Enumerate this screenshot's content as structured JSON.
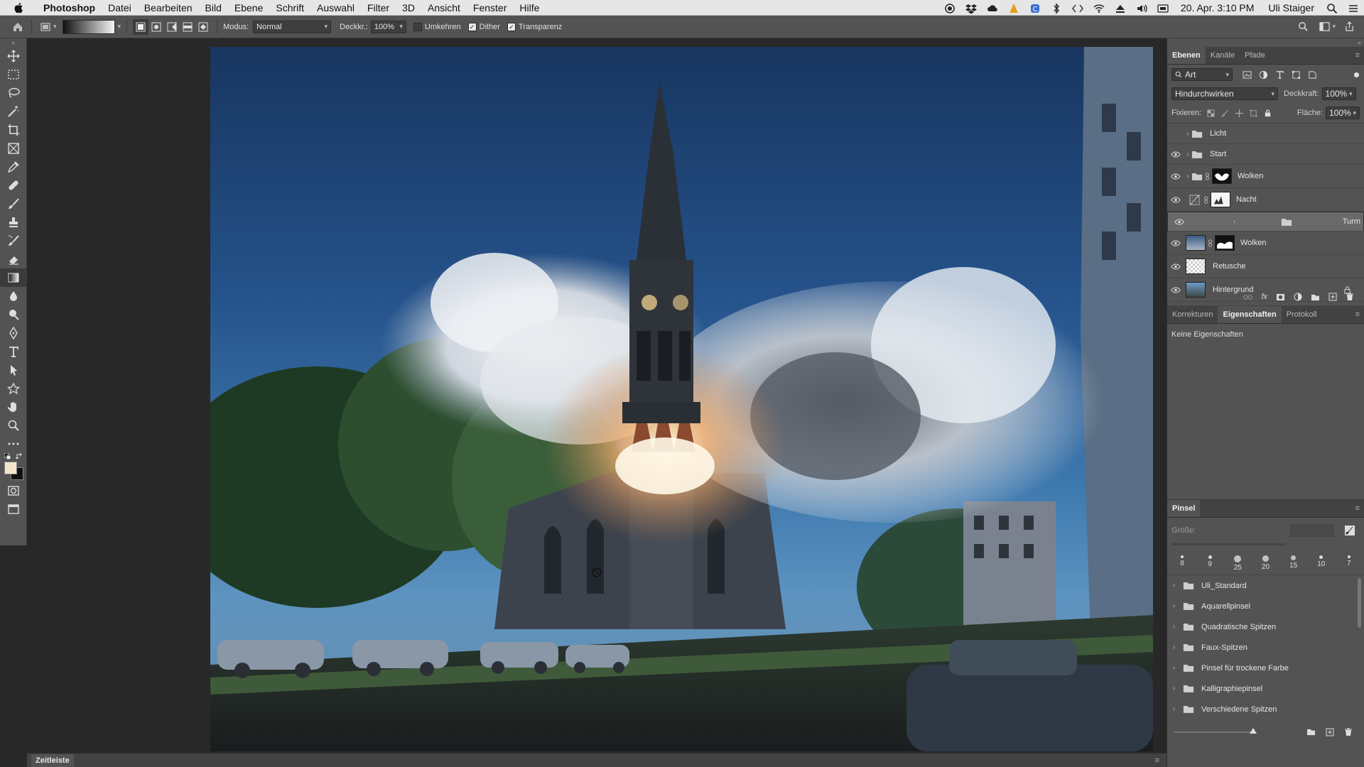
{
  "menubar": {
    "items": [
      "Photoshop",
      "Datei",
      "Bearbeiten",
      "Bild",
      "Ebene",
      "Schrift",
      "Auswahl",
      "Filter",
      "3D",
      "Ansicht",
      "Fenster",
      "Hilfe"
    ],
    "clock": "20. Apr. 3:10 PM",
    "user": "Uli Staiger"
  },
  "options": {
    "mode_label": "Modus:",
    "mode_value": "Normal",
    "opacity_label": "Deckkr.:",
    "opacity_value": "100%",
    "reverse_label": "Umkehren",
    "dither_label": "Dither",
    "transparency_label": "Transparenz",
    "reverse_checked": false,
    "dither_checked": true,
    "transparency_checked": true
  },
  "layers_panel": {
    "tabs": [
      "Ebenen",
      "Kanäle",
      "Pfade"
    ],
    "filter_value": "Art",
    "blend_value": "Hindurchwirken",
    "opacity_label": "Deckkraft:",
    "opacity_value": "100%",
    "lock_label": "Fixieren:",
    "fill_label": "Fläche:",
    "fill_value": "100%",
    "layers": [
      {
        "name": "Licht",
        "type": "group",
        "visible": false
      },
      {
        "name": "Start",
        "type": "group",
        "visible": true
      },
      {
        "name": "Wolken",
        "type": "group-mask",
        "visible": true
      },
      {
        "name": "Nacht",
        "type": "adjustment",
        "visible": true
      },
      {
        "name": "Turm",
        "type": "group",
        "visible": true,
        "selected": true
      },
      {
        "name": "Wolken",
        "type": "image-mask",
        "visible": true
      },
      {
        "name": "Retusche",
        "type": "transparent",
        "visible": true
      },
      {
        "name": "Hintergrund",
        "type": "image",
        "visible": true,
        "locked": true
      }
    ]
  },
  "properties_panel": {
    "tabs": [
      "Korrekturen",
      "Eigenschaften",
      "Protokoll"
    ],
    "empty_text": "Keine Eigenschaften"
  },
  "brush_panel": {
    "title": "Pinsel",
    "size_label": "Größe:",
    "tips": [
      "8",
      "9",
      "25",
      "20",
      "15",
      "10",
      "7"
    ],
    "folders": [
      "Uli_Standard",
      "Aquarellpinsel",
      "Quadratische Spitzen",
      "Faux-Spitzen",
      "Pinsel für trockene Farbe",
      "Kalligraphiepinsel",
      "Verschiedene Spitzen"
    ]
  },
  "timeline": {
    "label": "Zeitleiste"
  },
  "colors": {
    "foreground": "#f2e6cc",
    "background": "#111111",
    "ui_panel": "#535353"
  }
}
